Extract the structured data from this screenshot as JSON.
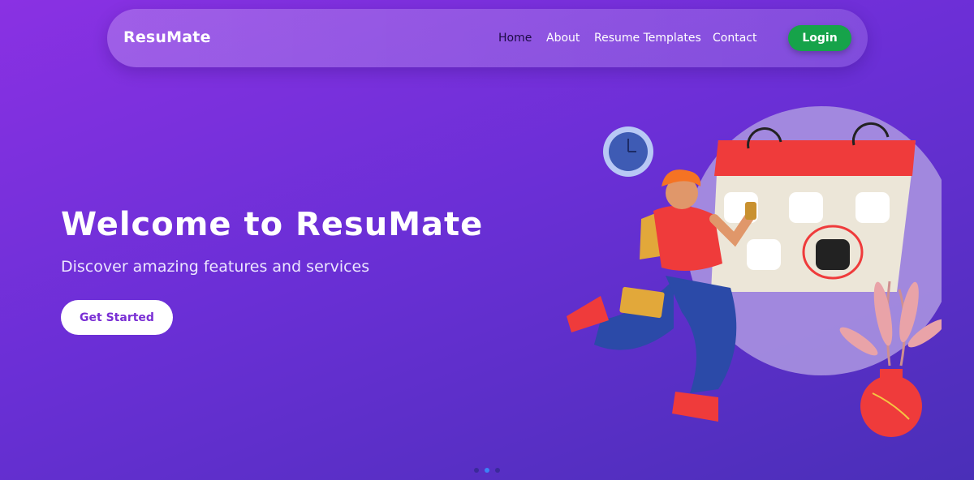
{
  "nav": {
    "brand": "ResuMate",
    "links": [
      {
        "label": "Home",
        "active": true
      },
      {
        "label": "About",
        "active": false
      },
      {
        "label": "Resume Templates",
        "active": false
      },
      {
        "label": "Contact",
        "active": false
      }
    ],
    "login_label": "Login"
  },
  "hero": {
    "title": "Welcome to ResuMate",
    "subtitle": "Discover amazing features and services",
    "cta_label": "Get Started"
  },
  "carousel": {
    "slide_count": 3,
    "active_index": 1
  },
  "colors": {
    "background_start": "#8a31e3",
    "background_end": "#4a2fb8",
    "login_button": "#16a34a",
    "cta_text": "#7a2fd4",
    "calendar_header": "#ef3b3b",
    "active_dot": "#3b82f6"
  },
  "icons": {
    "illustration": "person-running-with-calendar-illustration",
    "clock": "clock-icon",
    "plant": "potted-plant-icon"
  }
}
